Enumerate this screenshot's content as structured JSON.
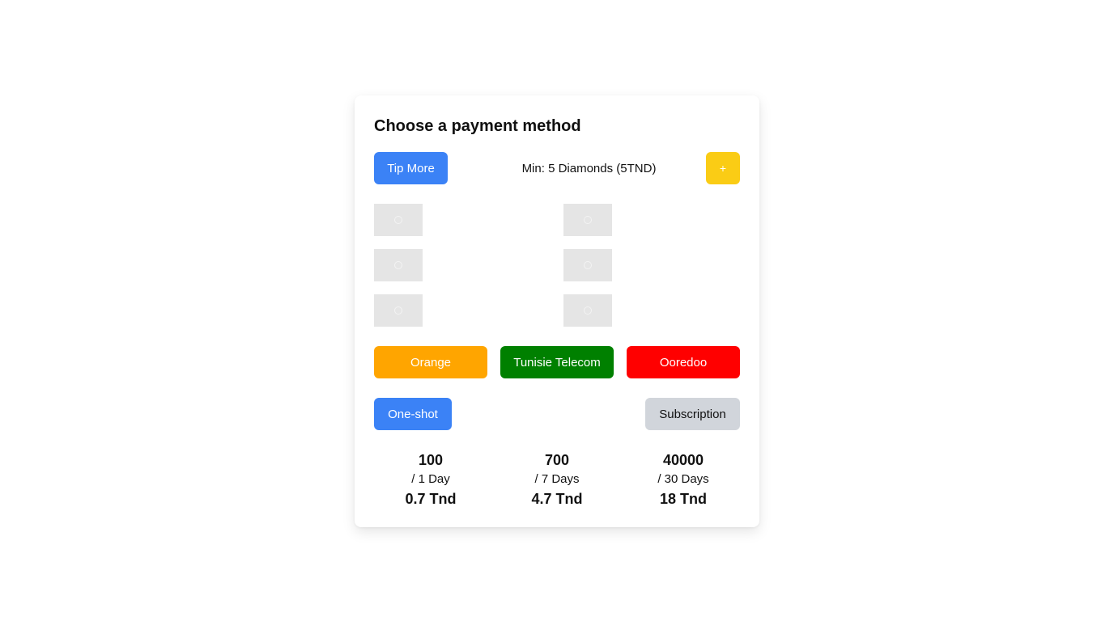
{
  "card": {
    "title": "Choose a payment method"
  },
  "tip": {
    "tip_more_label": "Tip More",
    "min_text": "Min: 5 Diamonds (5TND)",
    "plus_label": "+"
  },
  "payment_icons": [
    {
      "icon": "image-placeholder-icon"
    },
    {
      "icon": "image-placeholder-icon"
    },
    {
      "icon": "image-placeholder-icon"
    },
    {
      "icon": "image-placeholder-icon"
    },
    {
      "icon": "image-placeholder-icon"
    },
    {
      "icon": "image-placeholder-icon"
    }
  ],
  "operators": {
    "orange": "Orange",
    "tunisie_telecom": "Tunisie Telecom",
    "ooredoo": "Ooredoo"
  },
  "modes": {
    "one_shot": "One-shot",
    "subscription": "Subscription"
  },
  "plans": [
    {
      "amount": "100",
      "period": "/ 1 Day",
      "price": "0.7 Tnd"
    },
    {
      "amount": "700",
      "period": "/ 7 Days",
      "price": "4.7 Tnd"
    },
    {
      "amount": "40000",
      "period": "/ 30 Days",
      "price": "18 Tnd"
    }
  ],
  "colors": {
    "primary_blue": "#3b82f6",
    "plus_yellow": "#facc15",
    "orange": "#ffa500",
    "tunisie_telecom_green": "#008000",
    "ooredoo_red": "#ff0000",
    "subscription_gray": "#d1d5db"
  }
}
